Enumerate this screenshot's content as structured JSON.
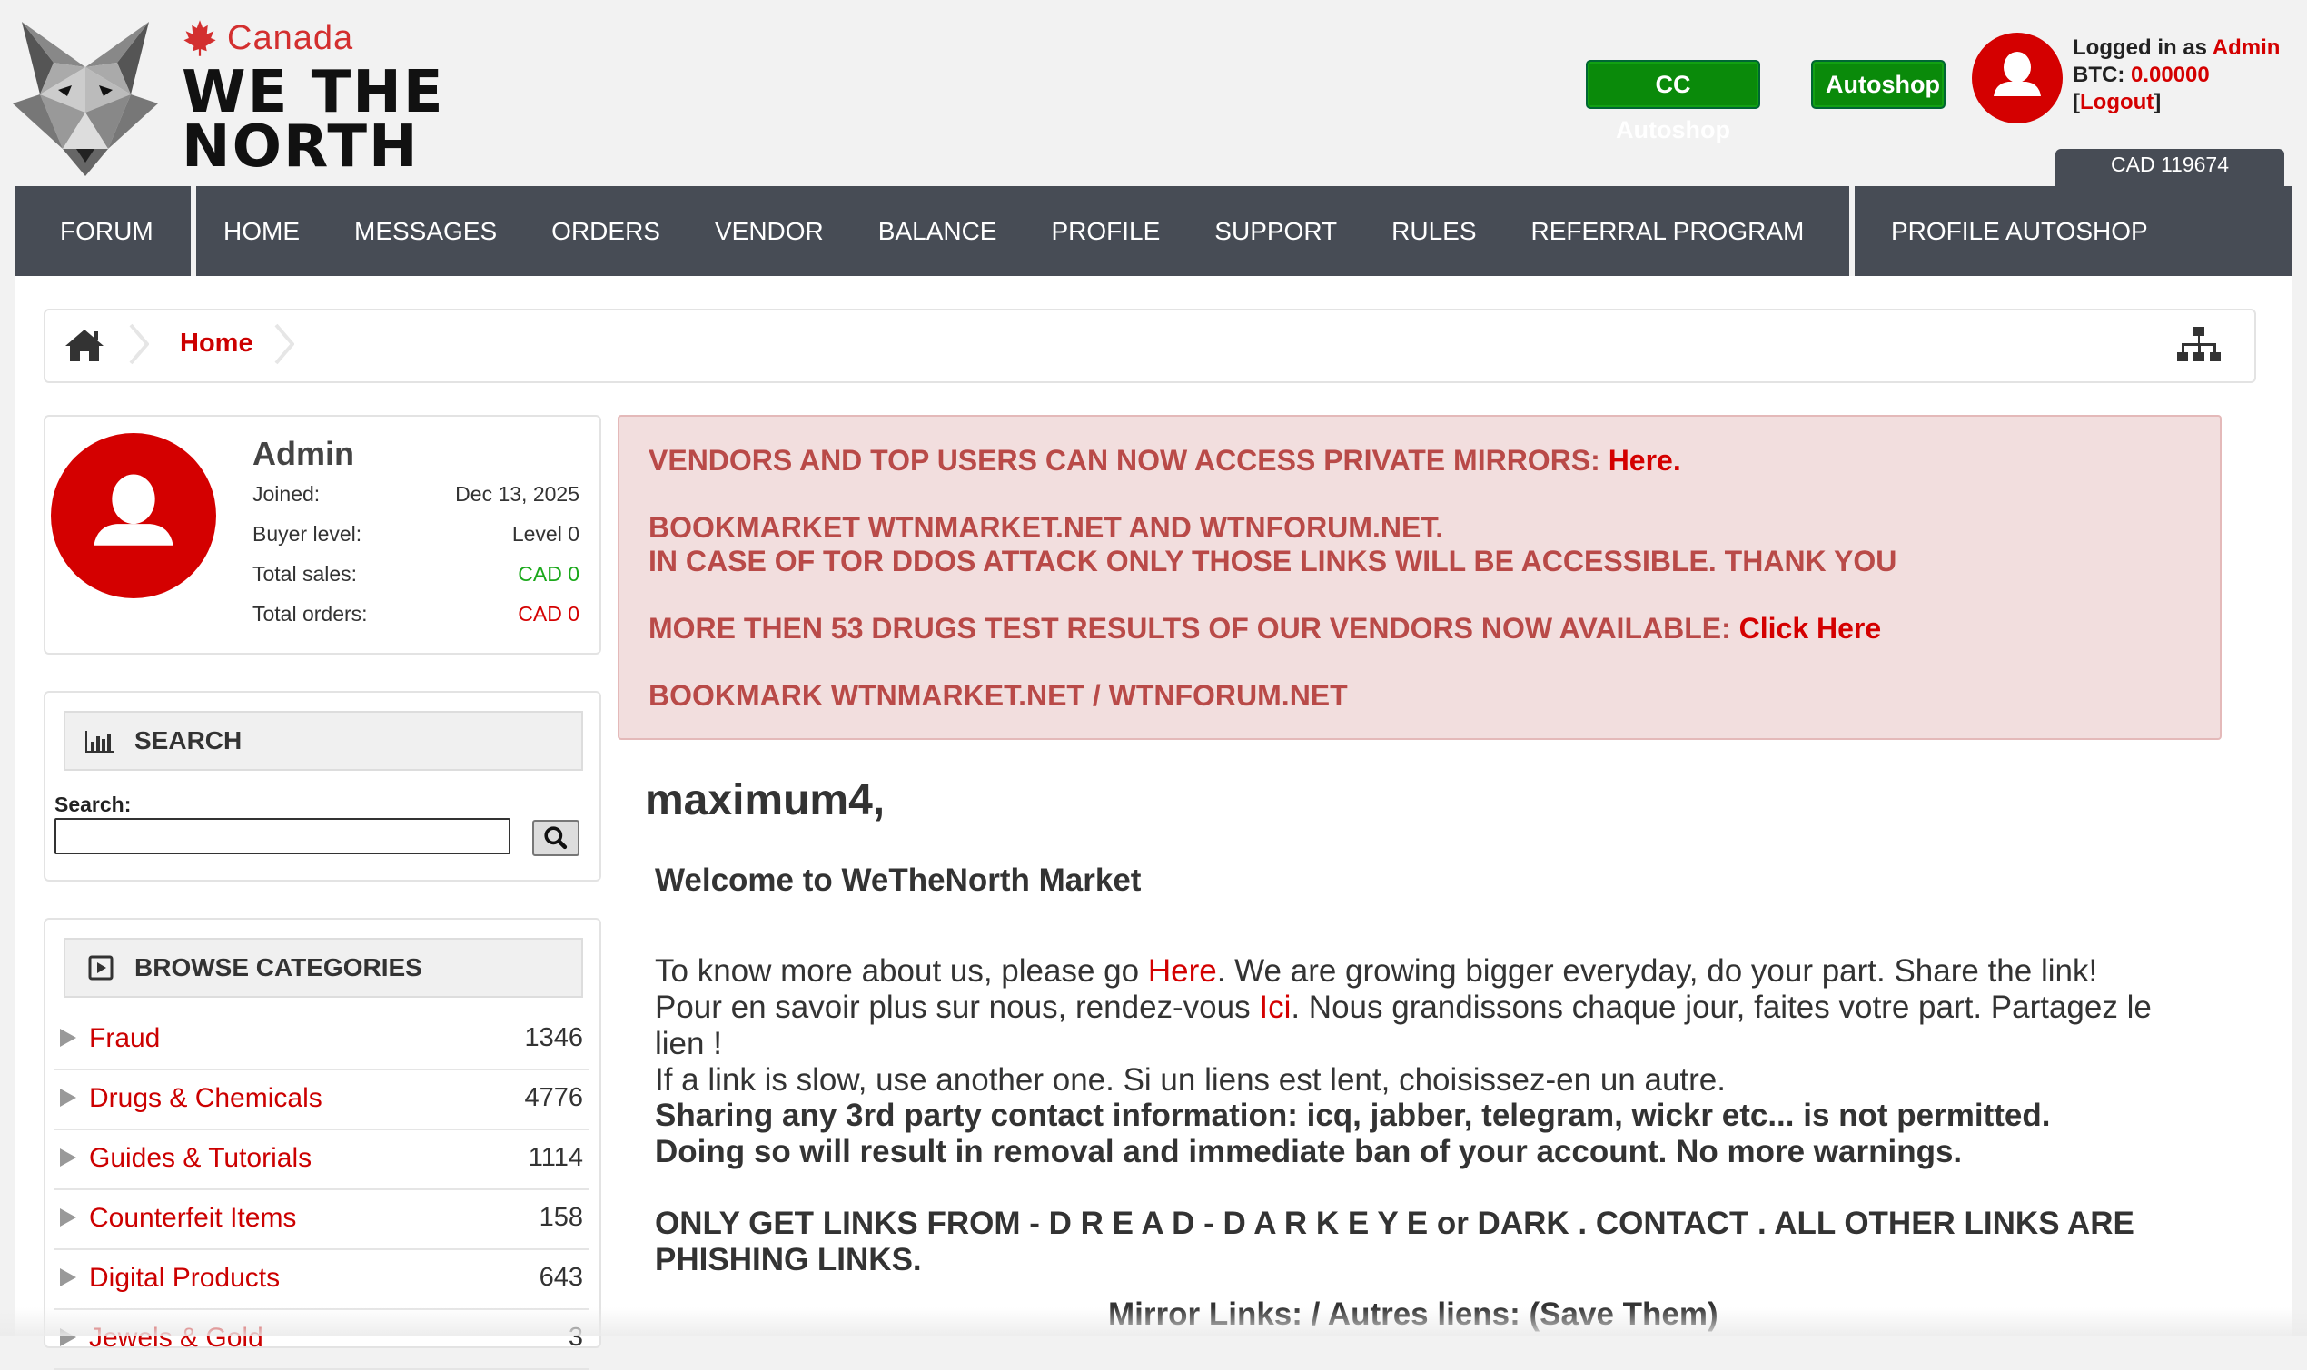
{
  "brand": {
    "country": "Canada",
    "title_line1": "WE THE",
    "title_line2": "NORTH",
    "logo_icon": "wolf-logo",
    "accent_color": "#d40000"
  },
  "header": {
    "cc_autoshop_label": "CC Autoshop",
    "autoshop_label": "Autoshop",
    "logged_in_prefix": "Logged in as ",
    "username": "Admin",
    "btc_prefix": "BTC: ",
    "btc_value": "0.00000",
    "logout_open": "[",
    "logout_label": "Logout",
    "logout_close": "]",
    "cad_balance": "CAD 119674"
  },
  "nav": {
    "forum": "FORUM",
    "items": [
      "HOME",
      "MESSAGES",
      "ORDERS",
      "VENDOR",
      "BALANCE",
      "PROFILE",
      "SUPPORT",
      "RULES",
      "REFERRAL PROGRAM"
    ],
    "profile_autoshop": "PROFILE AUTOSHOP"
  },
  "breadcrumb": {
    "home_label": "Home"
  },
  "profile": {
    "name": "Admin",
    "joined_label": "Joined:",
    "joined_value": "Dec 13, 2025",
    "buyer_level_label": "Buyer level:",
    "buyer_level_value": "Level 0",
    "total_sales_label": "Total sales:",
    "total_sales_value": "CAD 0",
    "total_orders_label": "Total orders:",
    "total_orders_value": "CAD 0"
  },
  "search": {
    "title": "SEARCH",
    "label": "Search:",
    "value": ""
  },
  "categories": {
    "title": "BROWSE CATEGORIES",
    "items": [
      {
        "label": "Fraud",
        "count": "1346"
      },
      {
        "label": "Drugs & Chemicals",
        "count": "4776"
      },
      {
        "label": "Guides & Tutorials",
        "count": "1114"
      },
      {
        "label": "Counterfeit Items",
        "count": "158"
      },
      {
        "label": "Digital Products",
        "count": "643"
      },
      {
        "label": "Jewels & Gold",
        "count": "3"
      }
    ]
  },
  "alert": {
    "line1": "VENDORS AND TOP USERS CAN NOW ACCESS PRIVATE MIRRORS: ",
    "line1_link": "Here.",
    "line2": "BOOKMARKET WTNMARKET.NET AND WTNFORUM.NET.",
    "line3": "IN CASE OF TOR DDOS ATTACK ONLY THOSE LINKS WILL BE ACCESSIBLE. THANK YOU",
    "line4": "MORE THEN 53 DRUGS TEST RESULTS OF OUR VENDORS NOW AVAILABLE: ",
    "line4_link": "Click Here",
    "line5": "BOOKMARK WTNMARKET.NET / WTNFORUM.NET"
  },
  "main": {
    "greeting": "maximum4,",
    "welcome_title": "Welcome to WeTheNorth Market",
    "p1_a": "To know more about us, please go ",
    "p1_link": "Here",
    "p1_b": ". We are growing bigger everyday, do your part. Share the link!",
    "p2_a": "Pour en savoir plus sur nous, rendez-vous ",
    "p2_link": "Ici",
    "p2_b": ". Nous grandissons chaque jour, faites votre part. Partagez le lien !",
    "p3": "If a link is slow, use another one. Si un liens est lent, choisissez-en un autre.",
    "p4": "Sharing any 3rd party contact information: icq, jabber, telegram, wickr etc... is not permitted.",
    "p5": "Doing so will result in removal and immediate ban of your account. No more warnings.",
    "p6": "ONLY GET LINKS FROM - D R E A D - D A R K E Y E or DARK . CONTACT . ALL OTHER LINKS ARE PHISHING LINKS.",
    "mirror_title": "Mirror Links: / Autres liens: (Save Them)"
  }
}
